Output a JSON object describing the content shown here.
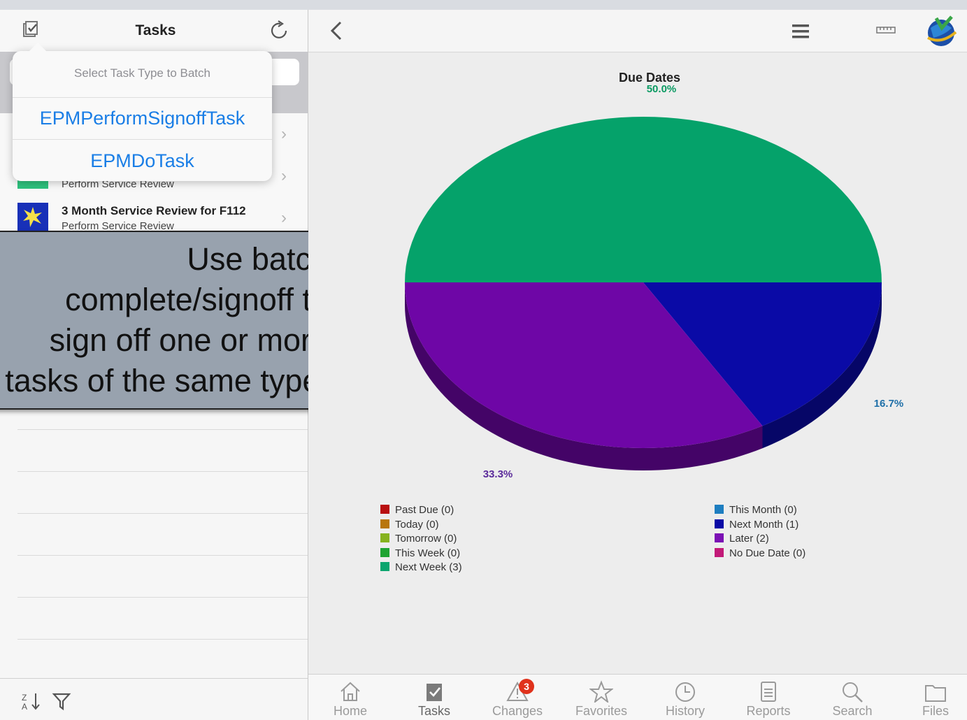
{
  "left": {
    "title": "Tasks",
    "tasks": [
      {
        "title": "",
        "subtitle": ""
      },
      {
        "title": "",
        "subtitle": "Perform Service Review"
      },
      {
        "title": "3 Month Service Review for F112",
        "subtitle": "Perform Service Review"
      }
    ]
  },
  "popover": {
    "header": "Select Task Type to Batch",
    "items": [
      "EPMPerformSignoffTask",
      "EPMDoTask"
    ]
  },
  "callout": {
    "text": "Use batch\ncomplete/signoff to\nsign off one or more\ntasks of the same type."
  },
  "chart_data": {
    "type": "pie",
    "title": "Due Dates",
    "slices": [
      {
        "label": "Next Week",
        "value": 3,
        "percent_label": "50.0%",
        "color": "#05a26a"
      },
      {
        "label": "Next Month",
        "value": 1,
        "percent_label": "16.7%",
        "color": "#0a0aa6"
      },
      {
        "label": "Later",
        "value": 2,
        "percent_label": "33.3%",
        "color": "#6e06a6"
      }
    ],
    "legend_left": [
      {
        "label": "Past Due (0)",
        "color": "#b81010"
      },
      {
        "label": "Today (0)",
        "color": "#b8760e"
      },
      {
        "label": "Tomorrow (0)",
        "color": "#86b21e"
      },
      {
        "label": "This Week (0)",
        "color": "#1ea332"
      },
      {
        "label": "Next Week (3)",
        "color": "#0aa56e"
      }
    ],
    "legend_right": [
      {
        "label": "This Month (0)",
        "color": "#1e7ec0"
      },
      {
        "label": "Next Month (1)",
        "color": "#0a0aa6"
      },
      {
        "label": "Later (2)",
        "color": "#7b10b4"
      },
      {
        "label": "No Due Date (0)",
        "color": "#c21a78"
      }
    ],
    "legend_position": "bottom"
  },
  "tabbar": {
    "tabs": [
      {
        "label": "Home",
        "icon": "home-icon"
      },
      {
        "label": "Tasks",
        "icon": "tasks-icon"
      },
      {
        "label": "Changes",
        "icon": "changes-icon",
        "badge": "3"
      },
      {
        "label": "Favorites",
        "icon": "favorites-icon"
      },
      {
        "label": "History",
        "icon": "history-icon"
      },
      {
        "label": "Reports",
        "icon": "reports-icon"
      },
      {
        "label": "Search",
        "icon": "search-icon"
      },
      {
        "label": "Files",
        "icon": "files-icon"
      }
    ],
    "active": "Tasks"
  }
}
